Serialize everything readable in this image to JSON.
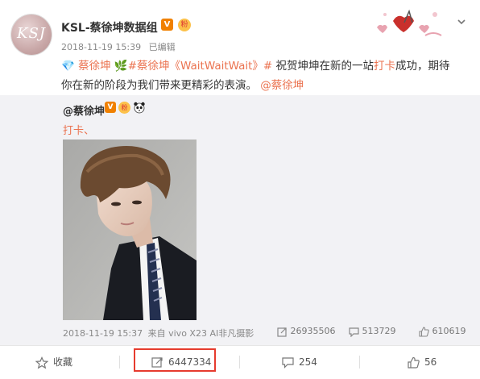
{
  "header": {
    "avatar_monogram": "KSJ",
    "username": "KSL-蔡徐坤数据组",
    "v_badge": "V",
    "fan_badge": "粉",
    "timestamp": "2018-11-19 15:39",
    "edited_label": "已编辑",
    "menu_icon": "chevron-down-icon"
  },
  "post": {
    "mention_1": "蔡徐坤",
    "hashtag": "#蔡徐坤《WaitWaitWait》#",
    "text_1": "祝贺坤坤在新的一站",
    "highlight": "打卡",
    "text_2": "成功，期待",
    "text_3": "你在新的阶段为我们带来更精彩的表演。",
    "mention_2": "@蔡徐坤"
  },
  "original": {
    "user": "@蔡徐坤",
    "text": "打卡、",
    "timestamp": "2018-11-19 15:37",
    "source": "来自 vivo X23 AI非凡摄影",
    "reposts": "26935506",
    "comments": "513729",
    "likes": "610619"
  },
  "actions": {
    "favorite": "收藏",
    "repost": "6447334",
    "comment": "254",
    "like": "56"
  },
  "colors": {
    "accent": "#eb7350",
    "highlight_border": "#e63b2e",
    "repost_bg": "#f2f2f5"
  }
}
